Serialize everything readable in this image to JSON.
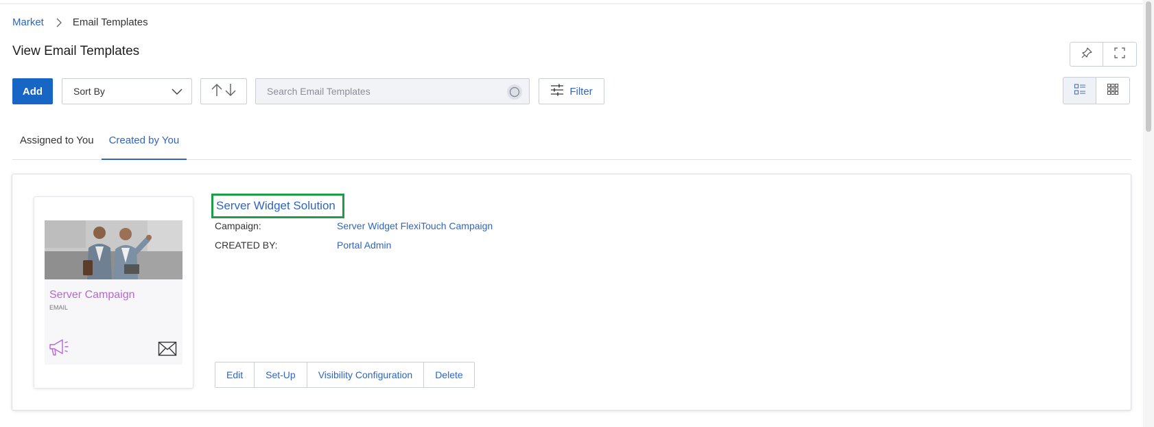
{
  "breadcrumb": {
    "parent": "Market",
    "current": "Email Templates"
  },
  "page": {
    "title": "View Email Templates"
  },
  "toolbar": {
    "add_label": "Add",
    "sort_label": "Sort By",
    "search_placeholder": "Search Email Templates",
    "filter_label": "Filter"
  },
  "tabs": [
    {
      "label": "Assigned to You",
      "active": false
    },
    {
      "label": "Created by You",
      "active": true
    }
  ],
  "result": {
    "title": "Server Widget Solution",
    "thumbnail": {
      "title": "Server Campaign",
      "subtitle": "EMAIL"
    },
    "meta": [
      {
        "key": "Campaign:",
        "value": "Server Widget FlexiTouch Campaign"
      },
      {
        "key": "CREATED BY:",
        "value": "Portal Admin"
      }
    ],
    "actions": [
      "Edit",
      "Set-Up",
      "Visibility Configuration",
      "Delete"
    ]
  },
  "colors": {
    "accent": "#1765c4",
    "link": "#2f65c2",
    "highlight": "#1f9d44",
    "thumb_title": "#b865d6"
  },
  "icons": [
    "chevron-right-icon",
    "pin-icon",
    "fullscreen-icon",
    "chevron-down-icon",
    "sort-up-icon",
    "sort-down-icon",
    "search-icon",
    "filter-sliders-icon",
    "list-view-icon",
    "grid-view-icon",
    "megaphone-icon",
    "envelope-icon"
  ]
}
